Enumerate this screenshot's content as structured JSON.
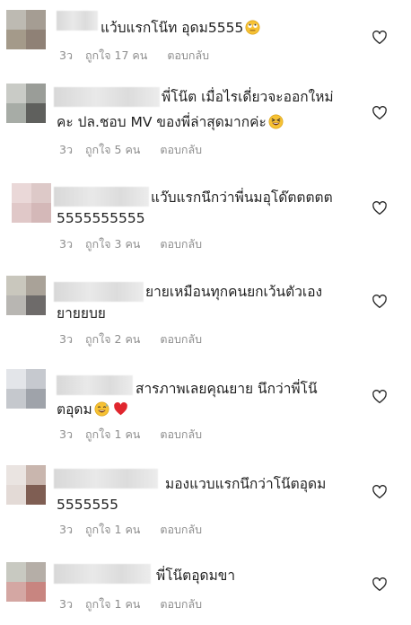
{
  "comments": [
    {
      "line1": "แว้บแรกโน๊ท อุดม5555",
      "line2": "",
      "emoji": "rolling-eyes",
      "time": "3ว",
      "likes": "ถูกใจ 17 คน",
      "reply": "ตอบกลับ"
    },
    {
      "line1": "พี่โน๊ต เมื่อไรเดี่ยวจะออกใหม่",
      "line2": "คะ ปล.ชอบ MV ของพี่ล่าสุดมากค่ะ",
      "emoji": "grinning-squint",
      "time": "3ว",
      "likes": "ถูกใจ 5 คน",
      "reply": "ตอบกลับ"
    },
    {
      "line1": "แว๊บแรกนึกว่าพี่นมอุโด๊ตตตตต",
      "line2": "5555555555",
      "emoji": "",
      "time": "3ว",
      "likes": "ถูกใจ 3 คน",
      "reply": "ตอบกลับ"
    },
    {
      "line1": "ยายเหมือนทุกคนยกเว้นตัวเอง",
      "line2": "ยายยบย",
      "emoji": "",
      "time": "3ว",
      "likes": "ถูกใจ 2 คน",
      "reply": "ตอบกลับ"
    },
    {
      "line1": "สารภาพเลยคุณยาย นึกว่าพี่โน๊",
      "line2": "ตอุดม",
      "emoji": "grin-sweat-heart",
      "time": "3ว",
      "likes": "ถูกใจ 1 คน",
      "reply": "ตอบกลับ"
    },
    {
      "line1": "มองแวบแรกนึกว่าโน๊ตอุดม",
      "line2": "5555555",
      "emoji": "",
      "time": "3ว",
      "likes": "ถูกใจ 1 คน",
      "reply": "ตอบกลับ"
    },
    {
      "line1": "พี่โน๊ตอุดมขา",
      "line2": "",
      "emoji": "",
      "time": "3ว",
      "likes": "ถูกใจ 1 คน",
      "reply": "ตอบกลับ"
    }
  ],
  "colors": {
    "meta": "#8e8e8e",
    "text": "#1f1f1f",
    "heart": "#262626"
  },
  "icons": {
    "like": "heart-outline-icon",
    "avatar": "pixelated-avatar"
  }
}
